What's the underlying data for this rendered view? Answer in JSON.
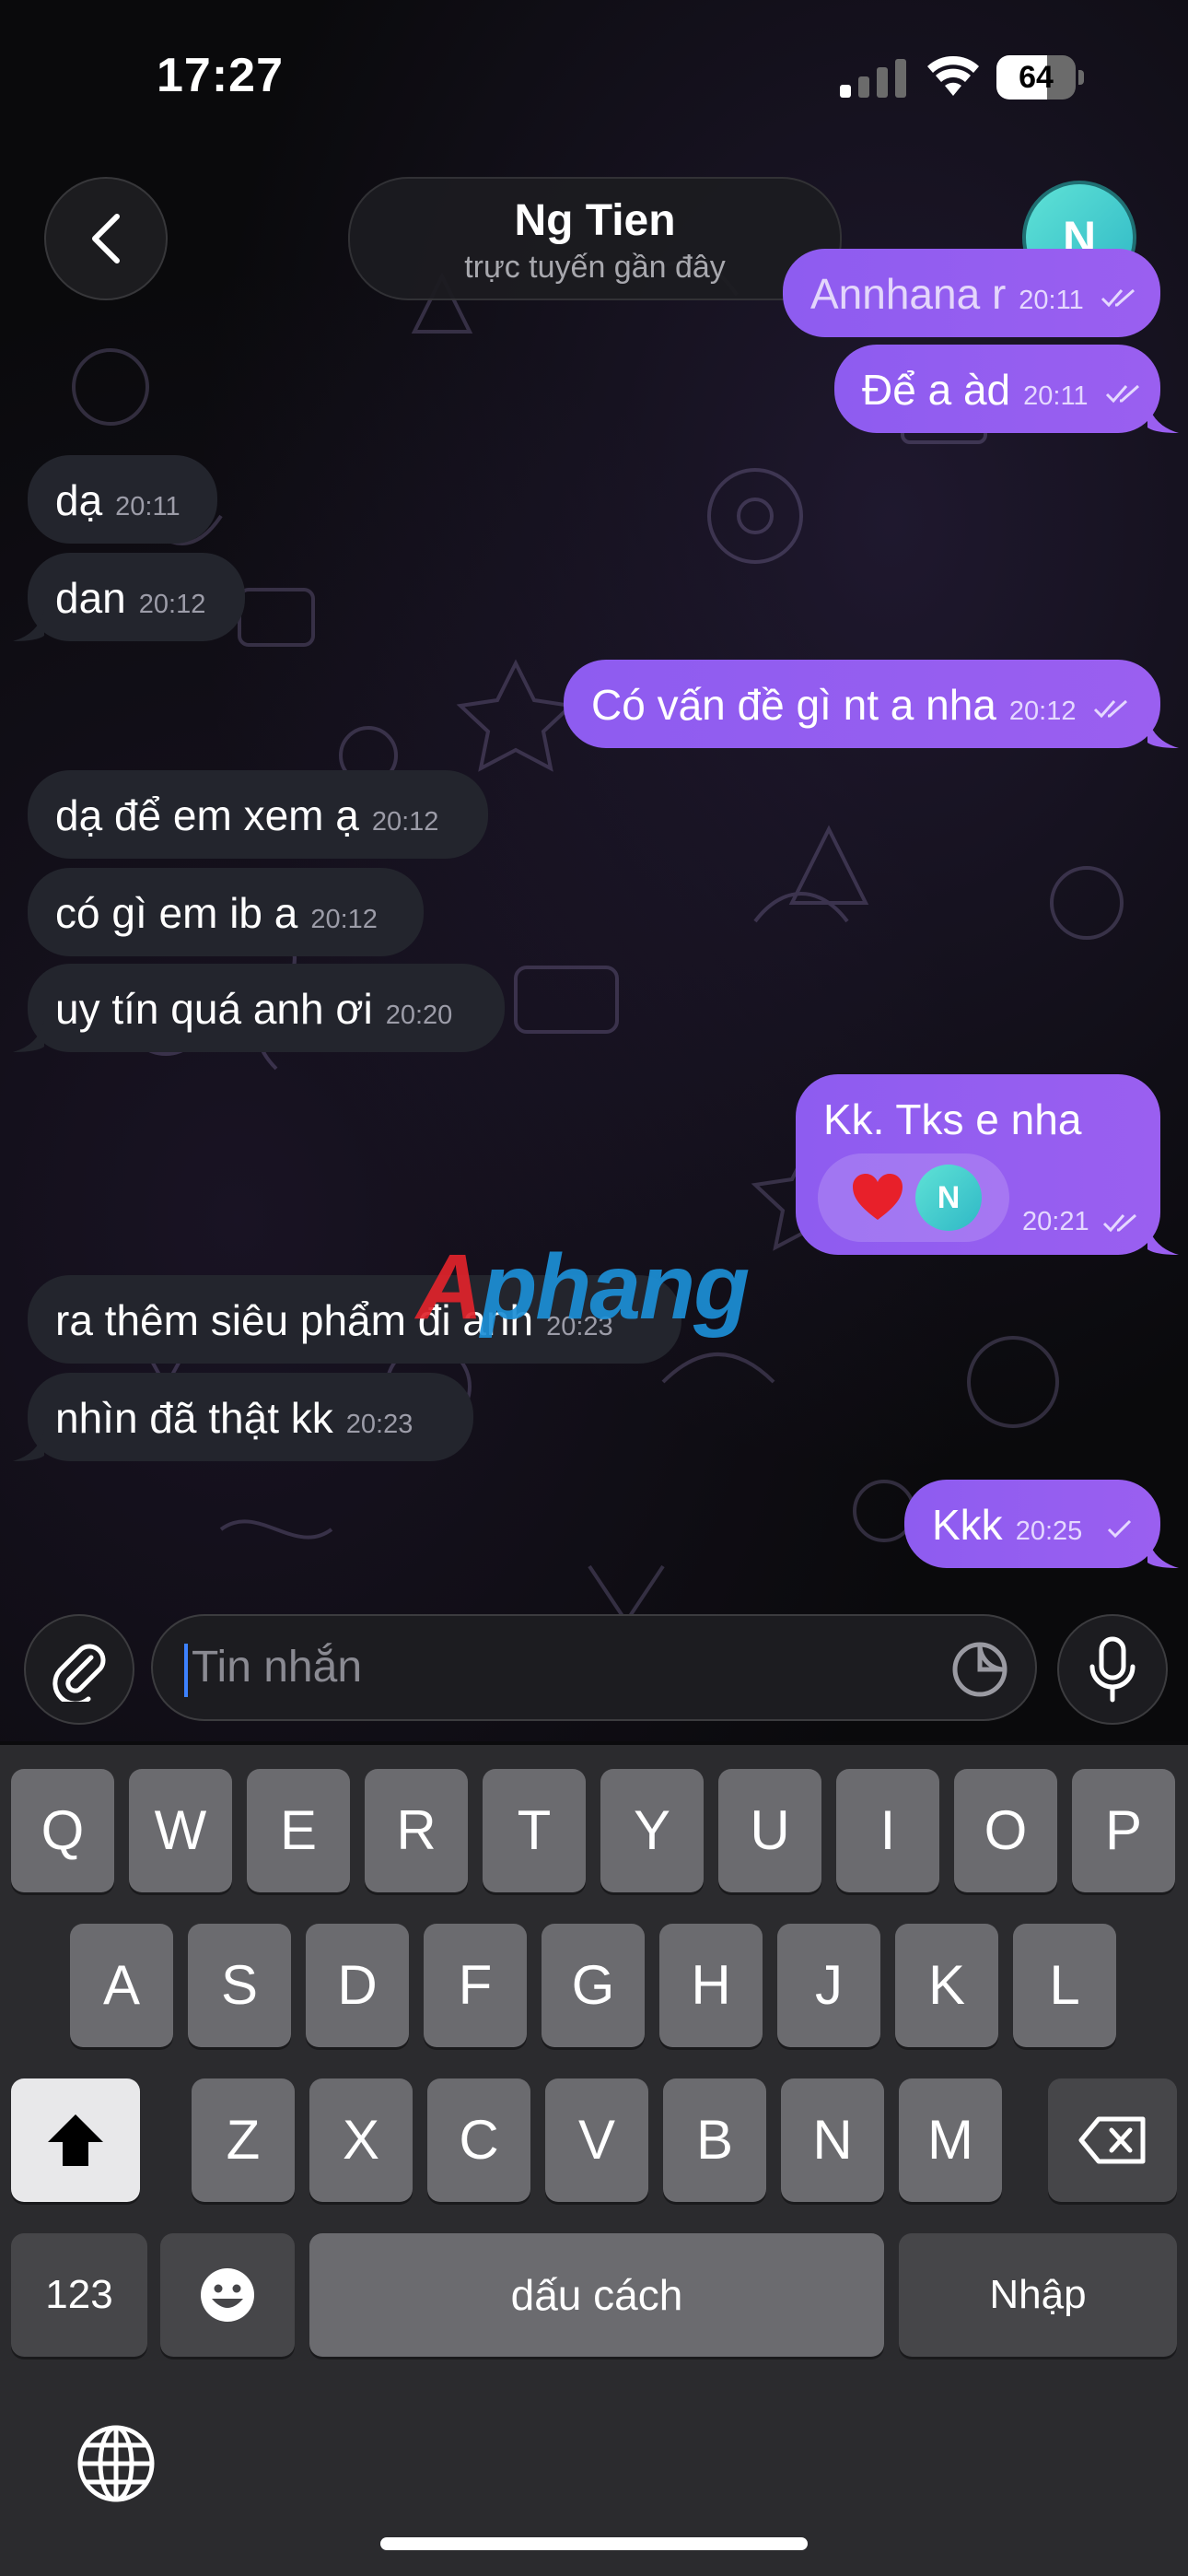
{
  "status_bar": {
    "time": "17:27",
    "battery": "64"
  },
  "header": {
    "contact_name": "Ng Tien",
    "contact_status": "trực tuyến gần đây",
    "avatar_initial": "N"
  },
  "messages": [
    {
      "dir": "out",
      "text": "Annhana r",
      "time": "20:11",
      "status": "read"
    },
    {
      "dir": "out",
      "text": "Để a àd",
      "time": "20:11",
      "status": "read"
    },
    {
      "dir": "in",
      "text": "dạ",
      "time": "20:11"
    },
    {
      "dir": "in",
      "text": "dan",
      "time": "20:12"
    },
    {
      "dir": "out",
      "text": "Có vấn đề gì nt a nha",
      "time": "20:12",
      "status": "read"
    },
    {
      "dir": "in",
      "text": "dạ để em xem ạ",
      "time": "20:12"
    },
    {
      "dir": "in",
      "text": "có gì em ib a",
      "time": "20:12"
    },
    {
      "dir": "in",
      "text": "uy tín quá anh ơi",
      "time": "20:20"
    },
    {
      "dir": "out",
      "text": "Kk. Tks e nha",
      "time": "20:21",
      "status": "read",
      "reaction": "heart",
      "reaction_avatar": "N"
    },
    {
      "dir": "in",
      "text": "ra thêm siêu phẩm đi anh",
      "time": "20:23"
    },
    {
      "dir": "in",
      "text": "nhìn đã thật kk",
      "time": "20:23"
    },
    {
      "dir": "out",
      "text": "Kkk",
      "time": "20:25",
      "status": "sent"
    }
  ],
  "watermark": {
    "first": "A",
    "rest": "phang"
  },
  "composer": {
    "placeholder": "Tin nhắn"
  },
  "keyboard": {
    "row1": [
      "Q",
      "W",
      "E",
      "R",
      "T",
      "Y",
      "U",
      "I",
      "O",
      "P"
    ],
    "row2": [
      "A",
      "S",
      "D",
      "F",
      "G",
      "H",
      "J",
      "K",
      "L"
    ],
    "row3": [
      "Z",
      "X",
      "C",
      "V",
      "B",
      "N",
      "M"
    ],
    "numbers_label": "123",
    "space_label": "dấu cách",
    "return_label": "Nhập"
  },
  "colors": {
    "outgoing_bubble": "#8b5cf6",
    "incoming_bubble": "#23252d",
    "avatar": "#3fc9cf"
  },
  "icons": {
    "back": "chevron-left-icon",
    "attach": "paperclip-icon",
    "sticker": "sticker-icon",
    "mic": "microphone-icon",
    "emoji": "emoji-icon",
    "globe": "globe-icon"
  }
}
